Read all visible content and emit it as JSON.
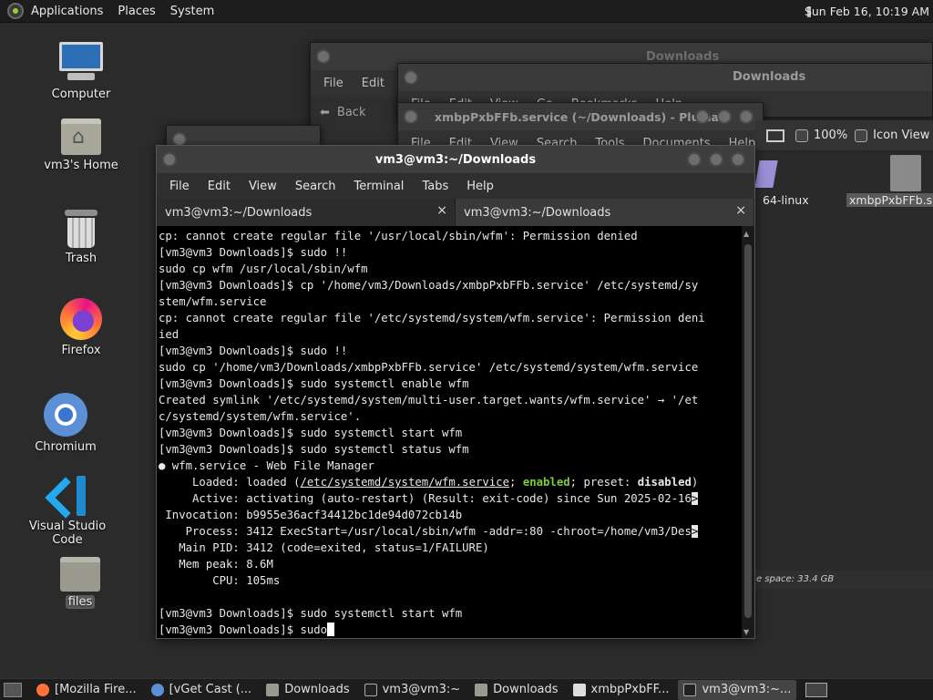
{
  "top_panel": {
    "menus": [
      "Applications",
      "Places",
      "System"
    ],
    "clock": "Sun Feb 16, 10:19 AM"
  },
  "desktop_icons": [
    {
      "label": "Computer",
      "icon": "computer-icon"
    },
    {
      "label": "vm3's Home",
      "icon": "home-folder-icon"
    },
    {
      "label": "Trash",
      "icon": "trash-icon"
    },
    {
      "label": "Firefox",
      "icon": "firefox-icon"
    },
    {
      "label": "Chromium",
      "icon": "chromium-icon"
    },
    {
      "label": "Visual Studio Code",
      "icon": "vscode-icon"
    },
    {
      "label": "files",
      "icon": "folder-icon"
    }
  ],
  "bg_windows": {
    "downloads_1": {
      "title": "Downloads",
      "menu": [
        "File",
        "Edit"
      ],
      "back_label": "Back"
    },
    "downloads_2": {
      "title": "Downloads",
      "menu": [
        "File",
        "Edit",
        "View",
        "Go",
        "Bookmarks",
        "Help"
      ]
    },
    "pluma": {
      "title": "xmbpPxbFFb.service (~/Downloads) - Pluma",
      "menu": [
        "File",
        "Edit",
        "View",
        "Search",
        "Tools",
        "Documents",
        "Help"
      ]
    }
  },
  "file_manager_right": {
    "zoom": "100%",
    "view_mode": "Icon View",
    "file_label_1": "64-linux",
    "file_label_2": "xmbpPxbFFb.s",
    "status": "e space: 33.4 GB"
  },
  "terminal": {
    "title": "vm3@vm3:~/Downloads",
    "menu": [
      "File",
      "Edit",
      "View",
      "Search",
      "Terminal",
      "Tabs",
      "Help"
    ],
    "tabs": [
      {
        "label": "vm3@vm3:~/Downloads",
        "close": "×"
      },
      {
        "label": "vm3@vm3:~/Downloads",
        "close": "×"
      }
    ],
    "lines": {
      "l01": "cp: cannot create regular file '/usr/local/sbin/wfm': Permission denied",
      "l02": "[vm3@vm3 Downloads]$ sudo !!",
      "l03": "sudo cp wfm /usr/local/sbin/wfm",
      "l04": "[vm3@vm3 Downloads]$ cp '/home/vm3/Downloads/xmbpPxbFFb.service' /etc/systemd/sy",
      "l05": "stem/wfm.service",
      "l06": "cp: cannot create regular file '/etc/systemd/system/wfm.service': Permission deni",
      "l07": "ied",
      "l08": "[vm3@vm3 Downloads]$ sudo !!",
      "l09": "sudo cp '/home/vm3/Downloads/xmbpPxbFFb.service' /etc/systemd/system/wfm.service",
      "l10": "[vm3@vm3 Downloads]$ sudo systemctl enable wfm",
      "l11": "Created symlink '/etc/systemd/system/multi-user.target.wants/wfm.service' → '/et",
      "l12": "c/systemd/system/wfm.service'.",
      "l13": "[vm3@vm3 Downloads]$ sudo systemctl start wfm",
      "l14": "[vm3@vm3 Downloads]$ sudo systemctl status wfm",
      "l15": "● wfm.service - Web File Manager",
      "l16_a": "     Loaded: loaded (",
      "l16_path": "/etc/systemd/system/wfm.service",
      "l16_b": "; ",
      "l16_enabled": "enabled",
      "l16_c": "; preset: ",
      "l16_disabled": "disabled",
      "l16_d": ")",
      "l17": "     Active: activating (auto-restart) (Result: exit-code) since Sun 2025-02-16",
      "l18": " Invocation: b9955e36acf34412bc1de94d072cb14b",
      "l19": "    Process: 3412 ExecStart=/usr/local/sbin/wfm -addr=:80 -chroot=/home/vm3/Des",
      "l20": "   Main PID: 3412 (code=exited, status=1/FAILURE)",
      "l21": "   Mem peak: 8.6M",
      "l22": "        CPU: 105ms",
      "l23": "",
      "l24": "[vm3@vm3 Downloads]$ sudo systemctl start wfm",
      "l25": "[vm3@vm3 Downloads]$ sudo",
      "more": ">"
    }
  },
  "taskbar": {
    "items": [
      {
        "label": "[Mozilla Fire...",
        "icon": "firefox-icon"
      },
      {
        "label": "[vGet Cast (...",
        "icon": "chromium-icon"
      },
      {
        "label": "Downloads",
        "icon": "folder-icon"
      },
      {
        "label": "vm3@vm3:~",
        "icon": "terminal-icon"
      },
      {
        "label": "Downloads",
        "icon": "folder-icon"
      },
      {
        "label": "xmbpPxbFF...",
        "icon": "text-editor-icon"
      },
      {
        "label": "vm3@vm3:~...",
        "icon": "terminal-icon"
      }
    ]
  }
}
